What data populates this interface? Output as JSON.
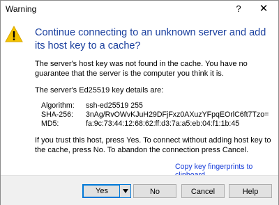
{
  "window": {
    "title": "Warning",
    "help_glyph": "?",
    "close_glyph": "✕"
  },
  "icon": {
    "name": "warning-icon",
    "fill": "#f5c400",
    "mark": "!"
  },
  "heading": "Continue connecting to an unknown server and add its host key to a cache?",
  "paragraphs": {
    "p1": "The server's host key was not found in the cache. You have no guarantee that the server is the computer you think it is.",
    "p2": "The server's Ed25519 key details are:",
    "p3": "If you trust this host, press Yes. To connect without adding host key to the cache, press No. To abandon the connection press Cancel."
  },
  "key_details": [
    {
      "label": "Algorithm:",
      "value": "ssh-ed25519 255"
    },
    {
      "label": "SHA-256:",
      "value": "3nAg/RvOWvKJuH29DFjFxz0AXuzYFpqEOrlC6ft7Tzo="
    },
    {
      "label": "MD5:",
      "value": "fa:9c:73:44:12:68:62:ff:d3:7a:a5:eb:04:f1:1b:45"
    }
  ],
  "copy_link": "Copy key fingerprints to clipboard",
  "buttons": {
    "yes": "Yes",
    "no": "No",
    "cancel": "Cancel",
    "help": "Help"
  },
  "colors": {
    "heading": "#1a3f9e",
    "link": "#1a3fd9",
    "focus_border": "#0078d7",
    "button_bar": "#f0f0f0"
  }
}
